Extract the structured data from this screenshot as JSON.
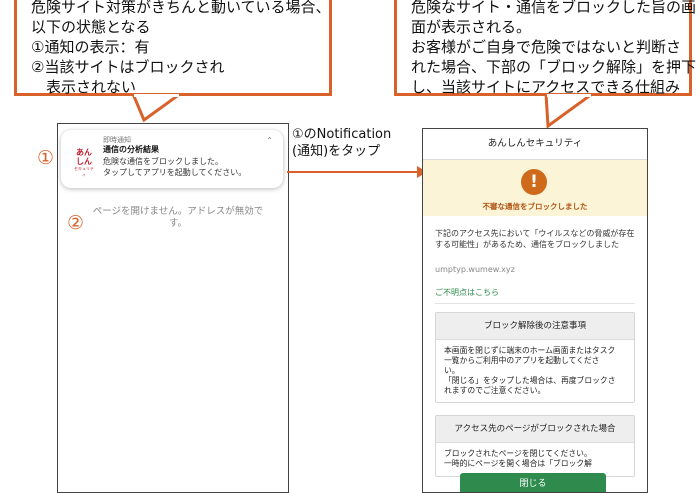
{
  "callouts": {
    "left": [
      "危険サイト対策がきちんと動いている場合、",
      "以下の状態となる",
      "①通知の表示：有",
      "②当該サイトはブロックされ",
      "　表示されない"
    ],
    "right": [
      "危険なサイト・通信をブロックした旨の画",
      "面が表示される。",
      "お客様がご自身で危険ではないと判断さ",
      "れた場合、下部の「ブロック解除」を押下",
      "し、当該サイトにアクセスできる仕組み"
    ]
  },
  "step_label": {
    "line1": "①のNotification",
    "line2": "(通知)をタップ"
  },
  "markers": {
    "one": "①",
    "two": "②"
  },
  "notification": {
    "logo_line1": "あんしん",
    "logo_line2": "セキュリティ",
    "app_label": "即時通知",
    "title": "通信の分析結果",
    "line1": "危険な通信をブロックしました。",
    "line2": "タップしてアプリを起動してください。"
  },
  "browser_error": "ページを開けません。アドレスが無効です。",
  "app": {
    "header_title": "あんしんセキュリティ",
    "warn_icon": "!",
    "warn_title": "不審な通信をブロックしました",
    "description": "下記のアクセス先において「ウイルスなどの脅威が存在する可能性」があるため、通信をブロックしました",
    "url": "umptyp.wumew.xyz",
    "help_link": "ご不明点はこちら",
    "notice1_title": "ブロック解除後の注意事項",
    "notice1_lines": [
      "本画面を閉じずに端末のホーム画面またはタスク",
      "一覧からご利用中のアプリを起動してくださ",
      "い。",
      "「閉じる」をタップした場合は、再度ブロックさ",
      "れますのでご注意ください。"
    ],
    "notice2_title": "アクセス先のページがブロックされた場合",
    "notice2_lines": [
      "ブロックされたページを閉じてください。",
      "一時的にページを開く場合は「ブロック解"
    ],
    "close_button": "閉じる"
  },
  "colors": {
    "accent": "#d9622b",
    "warn": "#d06a1b",
    "warn_bg": "#fbf4d6",
    "green": "#2e8a4d"
  }
}
